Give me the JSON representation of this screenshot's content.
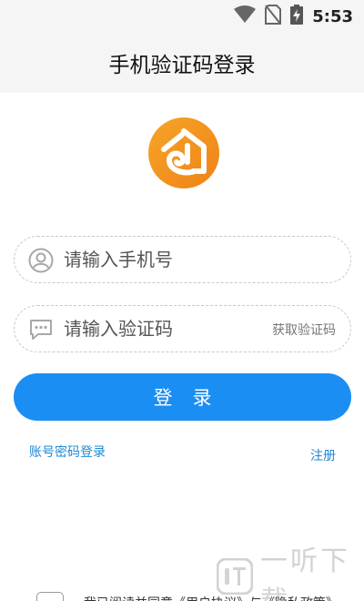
{
  "status_bar": {
    "time": "5:53",
    "icons": [
      "wifi-icon",
      "no-sim-icon",
      "battery-charging-icon"
    ]
  },
  "header": {
    "title": "手机验证码登录"
  },
  "logo": {
    "icon": "house-logo-icon",
    "colors": {
      "outer": "#f2941f",
      "inner": "#ffffff"
    }
  },
  "form": {
    "phone": {
      "placeholder": "请输入手机号",
      "value": "",
      "icon": "user-icon"
    },
    "code": {
      "placeholder": "请输入验证码",
      "value": "",
      "icon": "message-icon",
      "get_code_label": "获取验证码"
    },
    "login_label": "登录"
  },
  "links": {
    "password_login": "账号密码登录",
    "register": "注册"
  },
  "agreement": {
    "text": "我已阅读并同意《用户协议》与《隐私政策》"
  },
  "watermark": {
    "text": "一听下载",
    "icon": "listen-logo-icon"
  },
  "colors": {
    "accent": "#1a8ef3",
    "link": "#1e88d4",
    "header_bg": "#f5f5f5"
  }
}
